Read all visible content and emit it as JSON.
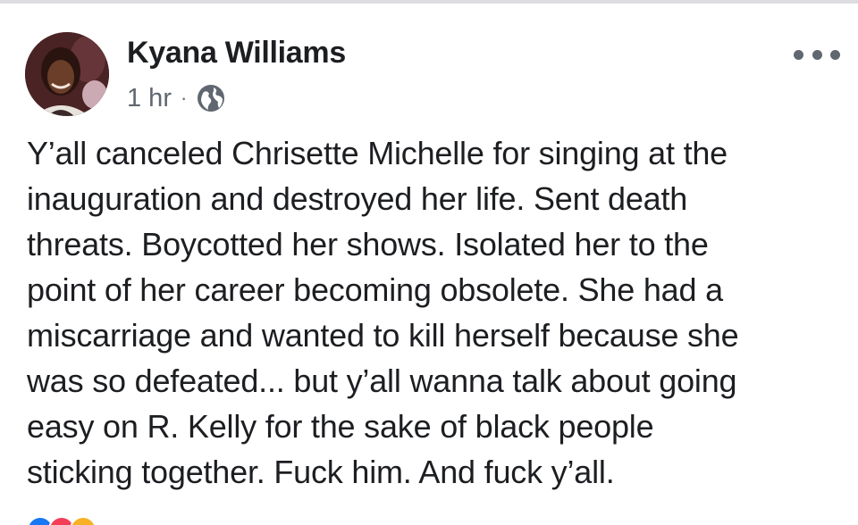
{
  "post": {
    "author_name": "Kyana Williams",
    "timestamp": "1 hr",
    "separator": "·",
    "privacy_icon": "globe-icon",
    "more_icon": "more-options-icon",
    "text_lines": [
      "Y’all canceled Chrisette Michelle for singing at the",
      "inauguration and destroyed her life. Sent death",
      "threats. Boycotted her shows. Isolated her to the",
      "point of her career becoming obsolete. She had a",
      "miscarriage and wanted to kill herself because she",
      "was so defeated... but y’all wanna talk about going",
      "easy on R. Kelly for the sake of black people",
      "sticking together. Fuck him. And fuck y’all."
    ],
    "reaction_icons": [
      "like-icon",
      "love-icon",
      "haha-icon"
    ],
    "colors": {
      "text": "#1c1e21",
      "meta": "#606770",
      "like": "#1877f2",
      "love": "#f33e58",
      "haha": "#f7b125"
    }
  }
}
